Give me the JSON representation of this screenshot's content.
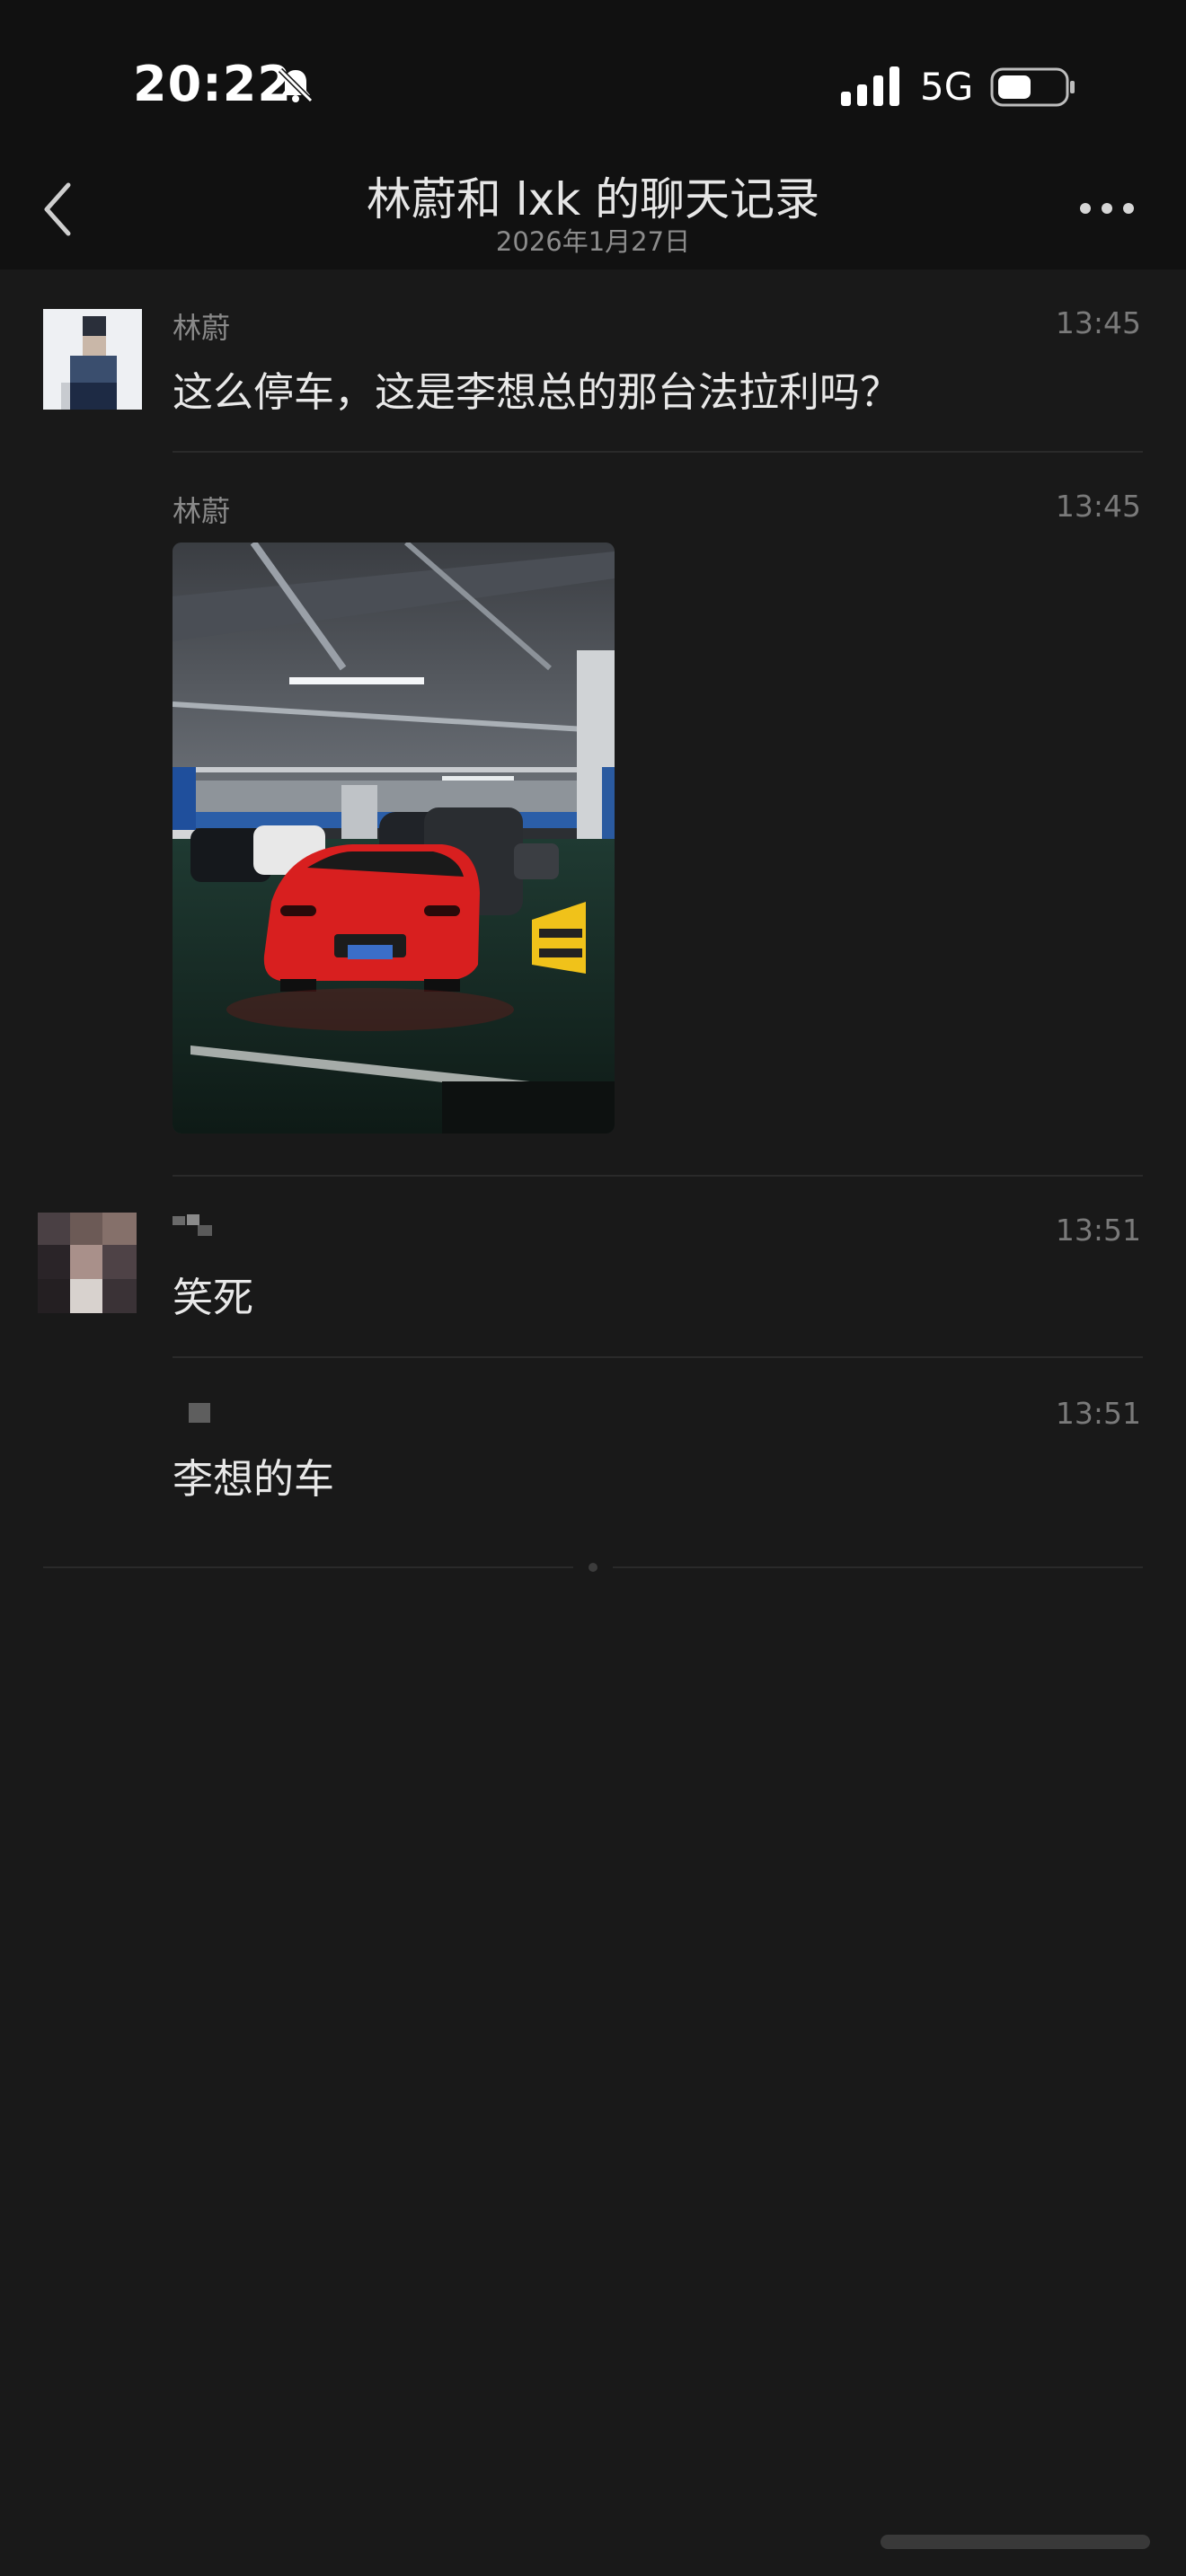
{
  "status_bar": {
    "time": "20:22",
    "network": "5G"
  },
  "nav": {
    "title": "林蔚和 lxk 的聊天记录",
    "subtitle": "2026年1月27日"
  },
  "messages": [
    {
      "sender": "林蔚",
      "time": "13:45",
      "text": "这么停车，这是李想总的那台法拉利吗？"
    },
    {
      "sender": "林蔚",
      "time": "13:45",
      "type": "image"
    },
    {
      "sender": "",
      "time": "13:51",
      "text": "笑死"
    },
    {
      "sender": "",
      "time": "13:51",
      "text": "李想的车"
    }
  ],
  "colors": {
    "background": "#191919",
    "header": "#111111",
    "text": "#e8e8e8",
    "muted": "#8a8a8a",
    "car_red": "#d81f1f"
  }
}
